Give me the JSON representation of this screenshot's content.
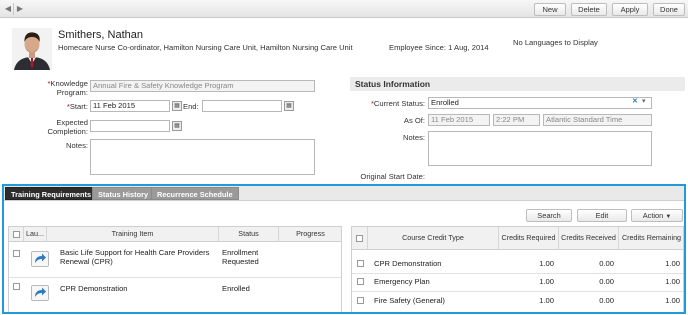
{
  "toolbar": {
    "buttons": [
      "New",
      "Delete",
      "Apply",
      "Done"
    ]
  },
  "employee": {
    "name": "Smithers, Nathan",
    "title": "Homecare Nurse Co-ordinator, Hamilton Nursing Care Unit, Hamilton Nursing Care Unit",
    "since": "Employee Since: 1 Aug, 2014",
    "languages": "No Languages to Display"
  },
  "form": {
    "knowledge_program_label": "Knowledge Program:",
    "knowledge_program_value": "Annual Fire & Safety Knowledge Program",
    "start_label": "Start:",
    "start_value": "11 Feb 2015",
    "end_label": "End:",
    "end_value": "",
    "expected_completion_label": "Expected Completion:",
    "expected_completion_value": "",
    "notes_label": "Notes:"
  },
  "status": {
    "header": "Status Information",
    "current_status_label": "Current Status:",
    "current_status_value": "Enrolled",
    "as_of_label": "As Of:",
    "as_of_date": "11 Feb 2015",
    "as_of_time": "2:22 PM",
    "as_of_tz": "Atlantic Standard Time",
    "notes_label": "Notes:",
    "original_start_label": "Original Start Date:",
    "original_start_value": ""
  },
  "tabs": [
    "Training Requirements",
    "Status History",
    "Recurrence Schedule"
  ],
  "actions": [
    "Search",
    "Edit",
    "Action"
  ],
  "training_grid": {
    "columns": [
      "Lau...",
      "Training Item",
      "Status",
      "Progress"
    ],
    "rows": [
      {
        "item": "Basic Life Support for Health Care Providers Renewal (CPR)",
        "status": "Enrollment Requested",
        "progress": ""
      },
      {
        "item": "CPR Demonstration",
        "status": "Enrolled",
        "progress": ""
      }
    ]
  },
  "credit_grid": {
    "columns": [
      "Course Credit Type",
      "Credits Required",
      "Credits Received",
      "Credits Remaining"
    ],
    "rows": [
      {
        "type": "CPR Demonstration",
        "required": "1.00",
        "received": "0.00",
        "remaining": "1.00"
      },
      {
        "type": "Emergency Plan",
        "required": "1.00",
        "received": "0.00",
        "remaining": "1.00"
      },
      {
        "type": "Fire Safety (General)",
        "required": "1.00",
        "received": "0.00",
        "remaining": "1.00"
      }
    ]
  },
  "colors": {
    "accent_border": "#1f9bd7",
    "required_marker": "#cc0000",
    "tab_active": "#2d2d2d",
    "tab_inactive": "#9a9a9a",
    "launch_icon": "#2e7bc4"
  },
  "icons": [
    "back-arrow-icon",
    "forward-arrow-icon",
    "calendar-icon",
    "clear-icon",
    "dropdown-icon",
    "launch-icon"
  ]
}
